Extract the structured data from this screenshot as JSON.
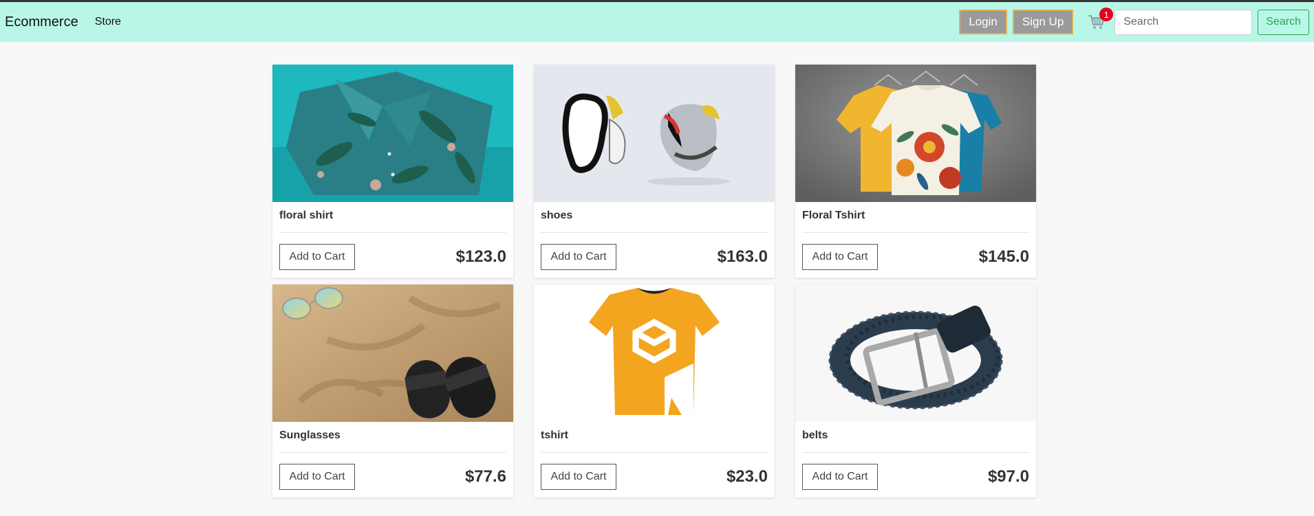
{
  "nav": {
    "brand": "Ecommerce",
    "store_link": "Store",
    "login_label": "Login",
    "signup_label": "Sign Up",
    "cart_count": "1",
    "search_placeholder": "Search",
    "search_button": "Search"
  },
  "products": [
    {
      "name": "floral shirt",
      "price": "$123.0",
      "button": "Add to Cart",
      "image": "floral-shirt-image"
    },
    {
      "name": "shoes",
      "price": "$163.0",
      "button": "Add to Cart",
      "image": "shoes-image"
    },
    {
      "name": "Floral Tshirt",
      "price": "$145.0",
      "button": "Add to Cart",
      "image": "floral-tshirt-image"
    },
    {
      "name": "Sunglasses",
      "price": "$77.6",
      "button": "Add to Cart",
      "image": "sunglasses-sandals-image"
    },
    {
      "name": "tshirt",
      "price": "$23.0",
      "button": "Add to Cart",
      "image": "tshirt-image"
    },
    {
      "name": "belts",
      "price": "$97.0",
      "button": "Add to Cart",
      "image": "belt-image"
    }
  ],
  "colors": {
    "navbar_bg": "#b8f7e8",
    "auth_button_bg": "#9a9a9a",
    "auth_button_border": "#e0b15a",
    "badge_red": "#e6001e",
    "search_green": "#28a745"
  }
}
